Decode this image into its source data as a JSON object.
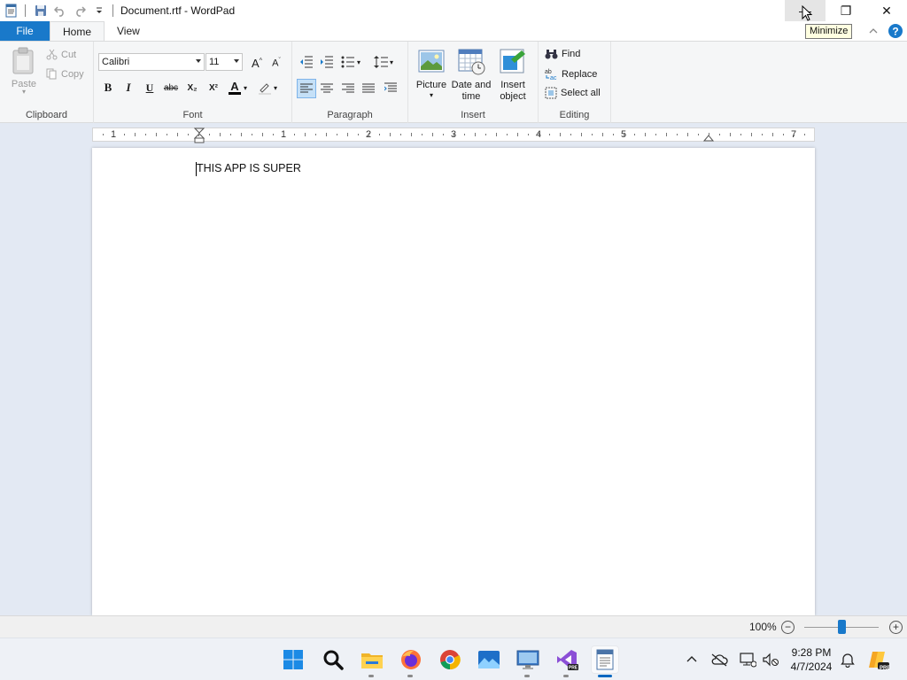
{
  "window": {
    "title": "Document.rtf - WordPad",
    "minimize_glyph": "—",
    "restore_glyph": "❐",
    "close_glyph": "✕",
    "tooltip": "Minimize"
  },
  "tabs": [
    {
      "label": "File"
    },
    {
      "label": "Home"
    },
    {
      "label": "View"
    }
  ],
  "clipboard": {
    "group_label": "Clipboard",
    "paste_label": "Paste",
    "cut_label": "Cut",
    "copy_label": "Copy"
  },
  "font": {
    "group_label": "Font",
    "family": "Calibri",
    "size": "11",
    "bold": "B",
    "italic": "I",
    "underline": "U",
    "strike": "abc",
    "subscript": "X₂",
    "superscript": "X²",
    "color_glyph": "A"
  },
  "paragraph": {
    "group_label": "Paragraph"
  },
  "insert": {
    "group_label": "Insert",
    "picture_label": "Picture",
    "datetime_label_1": "Date and",
    "datetime_label_2": "time",
    "object_label_1": "Insert",
    "object_label_2": "object"
  },
  "editing": {
    "group_label": "Editing",
    "find_label": "Find",
    "replace_label": "Replace",
    "select_all_label": "Select all"
  },
  "ruler": {
    "numbers": [
      "1",
      "1",
      "2",
      "3",
      "4",
      "5",
      "7"
    ]
  },
  "document": {
    "text": "THIS APP IS SUPER"
  },
  "status": {
    "zoom": "100%",
    "zoom_minus": "−",
    "zoom_plus": "+"
  },
  "taskbar": {
    "time": "9:28 PM",
    "date": "4/7/2024",
    "badge": "PRE"
  },
  "colors": {
    "accent": "#1979ca",
    "ribbon_bg": "#f5f6f7",
    "workspace_bg": "#e3e9f3",
    "taskbar_bg": "#eef1f6"
  }
}
